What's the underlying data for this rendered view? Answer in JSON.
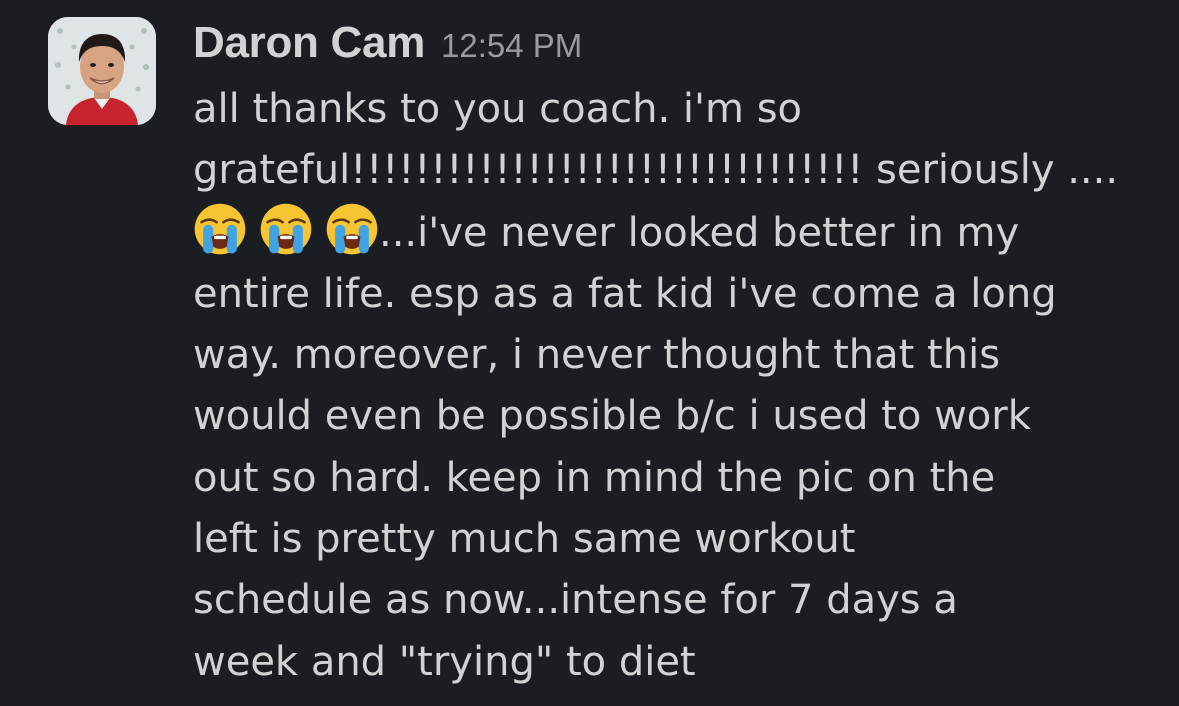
{
  "message": {
    "author": "Daron Cam",
    "timestamp": "12:54 PM",
    "avatar_icon": "user-avatar-photo",
    "emoji_icon": "loudly-crying-face-icon",
    "lines": {
      "l1": "all thanks to you coach. i'm so",
      "l2": "grateful!!!!!!!!!!!!!!!!!!!!!!!!!!!!!!!! seriously ....",
      "l3_after_emojis": "...i've never looked better in my",
      "l4": "entire life. esp as a fat kid i've come a long",
      "l5": "way. moreover, i never thought that this",
      "l6": "would even be possible b/c i used to work",
      "l7": "out so hard. keep in mind the pic on the",
      "l8": "left is pretty much same workout",
      "l9": "schedule as now...intense for 7 days a",
      "l10": "week and \"trying\" to diet"
    }
  },
  "colors": {
    "background": "#1a1d21",
    "text": "#d1d2d3",
    "timestamp": "#9a9b9e"
  }
}
